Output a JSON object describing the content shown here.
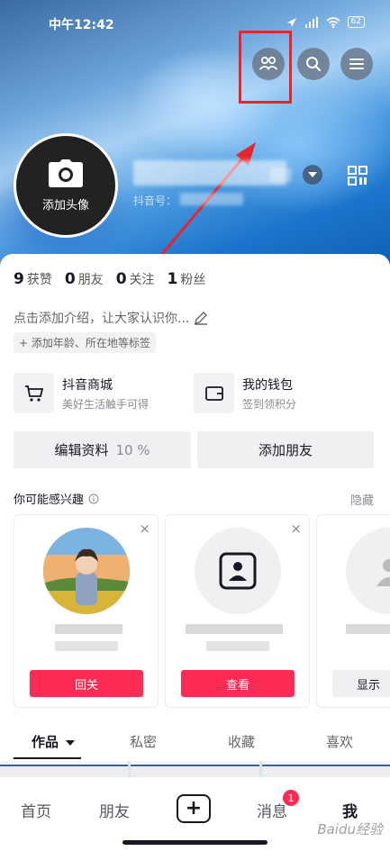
{
  "status_bar": {
    "time": "中午12:42",
    "battery": "62"
  },
  "header": {
    "buttons": [
      "friends-icon",
      "search-icon",
      "menu-icon"
    ],
    "avatar_label": "添加头像",
    "id_prefix": "抖音号："
  },
  "stats": [
    {
      "value": "9",
      "label": "获赞"
    },
    {
      "value": "0",
      "label": "朋友"
    },
    {
      "value": "0",
      "label": "关注"
    },
    {
      "value": "1",
      "label": "粉丝"
    }
  ],
  "bio": {
    "placeholder": "点击添加介绍，让大家认识你...",
    "tag_chip": "+ 添加年龄、所在地等标签"
  },
  "services": [
    {
      "title": "抖音商城",
      "subtitle": "美好生活触手可得",
      "icon": "cart-icon"
    },
    {
      "title": "我的钱包",
      "subtitle": "签到领积分",
      "icon": "wallet-icon"
    }
  ],
  "actions": {
    "edit_profile": "编辑资料",
    "edit_progress": "10 %",
    "add_friend": "添加朋友"
  },
  "suggestions": {
    "heading": "你可能感兴趣",
    "hide": "隐藏",
    "cards": [
      {
        "button": "回关",
        "close": "×"
      },
      {
        "button": "查看",
        "close": "×"
      },
      {
        "button": "显示"
      }
    ]
  },
  "tabs": [
    "作品",
    "私密",
    "收藏",
    "喜欢"
  ],
  "nav": {
    "items": [
      "首页",
      "朋友",
      "消息",
      "我"
    ],
    "badge": "1",
    "plus": "+"
  },
  "watermark": "Baidu经验",
  "colors": {
    "accent": "#fe2c55",
    "highlight": "#e8242c"
  }
}
